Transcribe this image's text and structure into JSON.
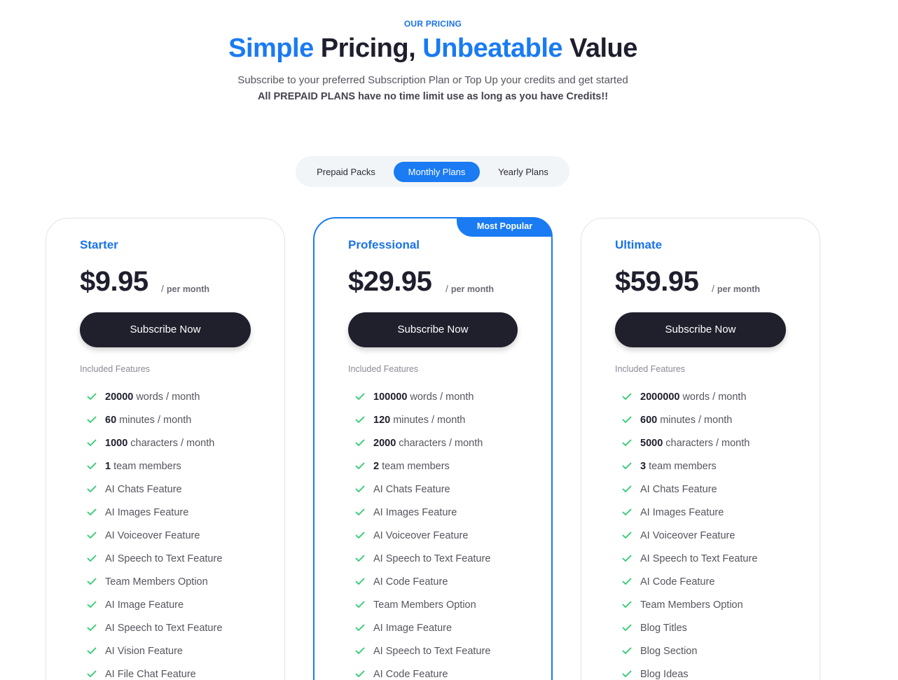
{
  "header": {
    "eyebrow": "OUR PRICING",
    "title_part1": "Simple",
    "title_part2": " Pricing, ",
    "title_part3": "Unbeatable",
    "title_part4": " Value",
    "subtitle": "Subscribe to your preferred Subscription Plan or Top Up your credits and get started",
    "subtitle_bold": "All PREPAID PLANS have no time limit use as long as you have Credits!!"
  },
  "toggle": {
    "options": [
      "Prepaid Packs",
      "Monthly Plans",
      "Yearly Plans"
    ],
    "selected": "Monthly Plans"
  },
  "colors": {
    "accent": "#1a7bf2",
    "dark_button": "#20202d",
    "check": "#2ecc71"
  },
  "plans": [
    {
      "name": "Starter",
      "price": "$9.95",
      "period": "per month",
      "button": "Subscribe Now",
      "included_label": "Included Features",
      "features": [
        {
          "num": "20000",
          "text": "words / month"
        },
        {
          "num": "60",
          "text": "minutes / month"
        },
        {
          "num": "1000",
          "text": "characters / month"
        },
        {
          "num": "1",
          "text": "team members"
        },
        {
          "num": "",
          "text": "AI Chats Feature"
        },
        {
          "num": "",
          "text": "AI Images Feature"
        },
        {
          "num": "",
          "text": "AI Voiceover Feature"
        },
        {
          "num": "",
          "text": "AI Speech to Text Feature"
        },
        {
          "num": "",
          "text": "Team Members Option"
        },
        {
          "num": "",
          "text": "AI Image Feature"
        },
        {
          "num": "",
          "text": "AI Speech to Text Feature"
        },
        {
          "num": "",
          "text": "AI Vision Feature"
        },
        {
          "num": "",
          "text": "AI File Chat Feature"
        }
      ]
    },
    {
      "name": "Professional",
      "price": "$29.95",
      "period": "per month",
      "button": "Subscribe Now",
      "badge": "Most Popular",
      "included_label": "Included Features",
      "features": [
        {
          "num": "100000",
          "text": "words / month"
        },
        {
          "num": "120",
          "text": "minutes / month"
        },
        {
          "num": "2000",
          "text": "characters / month"
        },
        {
          "num": "2",
          "text": "team members"
        },
        {
          "num": "",
          "text": "AI Chats Feature"
        },
        {
          "num": "",
          "text": "AI Images Feature"
        },
        {
          "num": "",
          "text": "AI Voiceover Feature"
        },
        {
          "num": "",
          "text": "AI Speech to Text Feature"
        },
        {
          "num": "",
          "text": "AI Code Feature"
        },
        {
          "num": "",
          "text": "Team Members Option"
        },
        {
          "num": "",
          "text": "AI Image Feature"
        },
        {
          "num": "",
          "text": "AI Speech to Text Feature"
        },
        {
          "num": "",
          "text": "AI Code Feature"
        }
      ]
    },
    {
      "name": "Ultimate",
      "price": "$59.95",
      "period": "per month",
      "button": "Subscribe Now",
      "included_label": "Included Features",
      "features": [
        {
          "num": "2000000",
          "text": "words / month"
        },
        {
          "num": "600",
          "text": "minutes / month"
        },
        {
          "num": "5000",
          "text": "characters / month"
        },
        {
          "num": "3",
          "text": "team members"
        },
        {
          "num": "",
          "text": "AI Chats Feature"
        },
        {
          "num": "",
          "text": "AI Images Feature"
        },
        {
          "num": "",
          "text": "AI Voiceover Feature"
        },
        {
          "num": "",
          "text": "AI Speech to Text Feature"
        },
        {
          "num": "",
          "text": "AI Code Feature"
        },
        {
          "num": "",
          "text": "Team Members Option"
        },
        {
          "num": "",
          "text": "Blog Titles"
        },
        {
          "num": "",
          "text": "Blog Section"
        },
        {
          "num": "",
          "text": "Blog Ideas"
        }
      ]
    }
  ]
}
